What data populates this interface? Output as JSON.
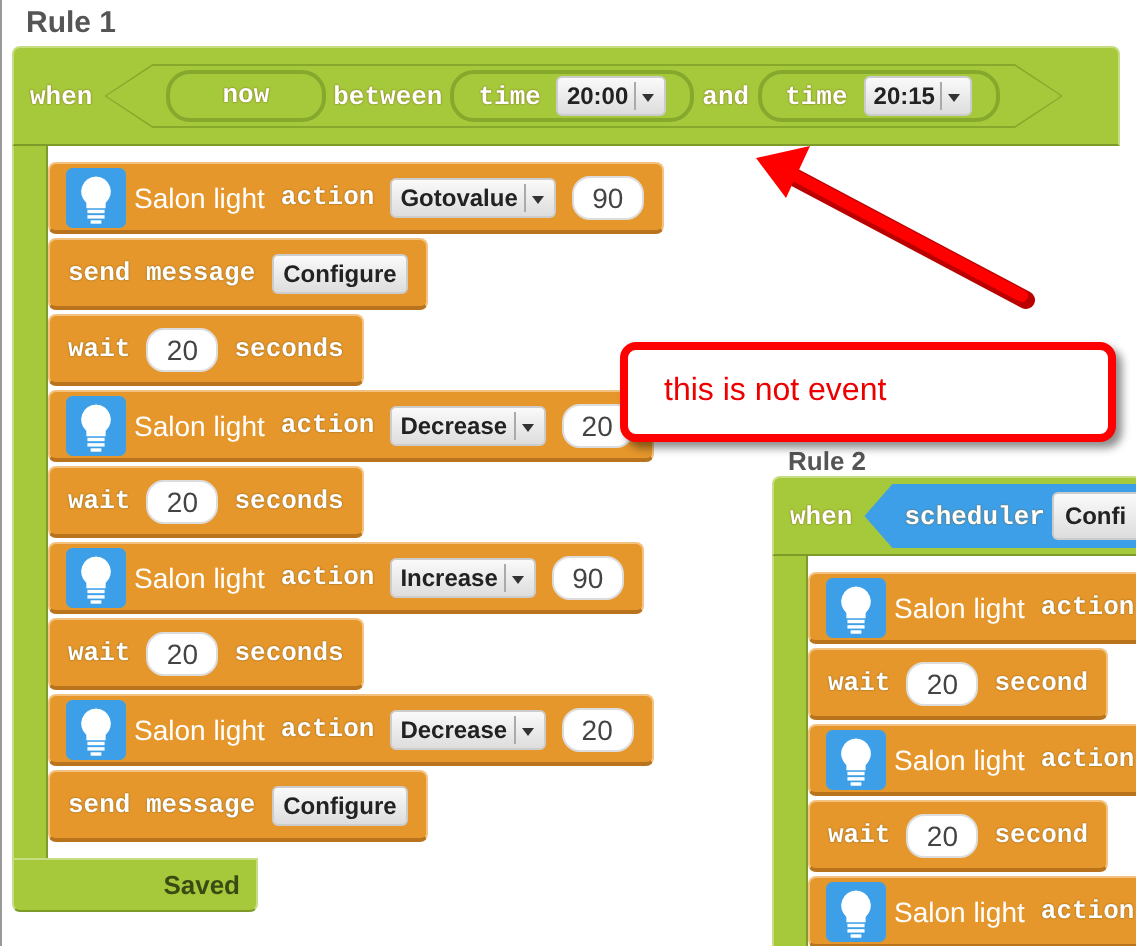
{
  "rules": [
    {
      "title": "Rule 1",
      "trigger": {
        "kind": "time_range",
        "label": "when",
        "subject": "now",
        "between": "between",
        "start": {
          "label": "time",
          "value": "20:00"
        },
        "and": "and",
        "end": {
          "label": "time",
          "value": "20:15"
        }
      },
      "actions": [
        {
          "kind": "device",
          "device": "Salon light",
          "label": "action",
          "option": "Gotovalue",
          "value": "90"
        },
        {
          "kind": "message",
          "label": "send message",
          "value": "Configure"
        },
        {
          "kind": "wait",
          "label": "wait",
          "value": "20",
          "unit": "seconds"
        },
        {
          "kind": "device",
          "device": "Salon light",
          "label": "action",
          "option": "Decrease",
          "value": "20"
        },
        {
          "kind": "wait",
          "label": "wait",
          "value": "20",
          "unit": "seconds"
        },
        {
          "kind": "device",
          "device": "Salon light",
          "label": "action",
          "option": "Increase",
          "value": "90"
        },
        {
          "kind": "wait",
          "label": "wait",
          "value": "20",
          "unit": "seconds"
        },
        {
          "kind": "device",
          "device": "Salon light",
          "label": "action",
          "option": "Decrease",
          "value": "20"
        },
        {
          "kind": "message",
          "label": "send message",
          "value": "Configure"
        }
      ],
      "footer": "Saved"
    },
    {
      "title": "Rule 2",
      "trigger": {
        "kind": "scheduler",
        "label": "when",
        "name": "scheduler",
        "value": "Confi"
      },
      "actions": [
        {
          "kind": "device",
          "device": "Salon light",
          "label": "action"
        },
        {
          "kind": "wait",
          "label": "wait",
          "value": "20",
          "unit": "second"
        },
        {
          "kind": "device",
          "device": "Salon light",
          "label": "action"
        },
        {
          "kind": "wait",
          "label": "wait",
          "value": "20",
          "unit": "second"
        },
        {
          "kind": "device",
          "device": "Salon light",
          "label": "action"
        }
      ]
    }
  ],
  "callout": {
    "text": "this is not event"
  }
}
